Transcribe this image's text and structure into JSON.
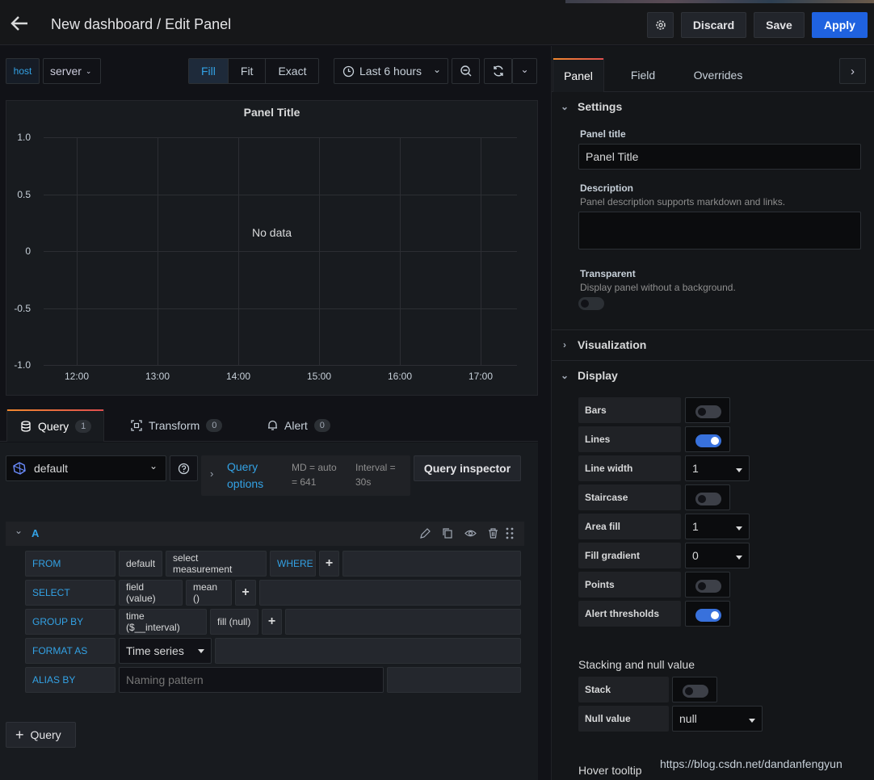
{
  "header": {
    "title": "New dashboard / Edit Panel",
    "discard_label": "Discard",
    "save_label": "Save",
    "apply_label": "Apply"
  },
  "toolbar": {
    "var_name": "host",
    "var_value": "server",
    "fit_modes": [
      "Fill",
      "Fit",
      "Exact"
    ],
    "active_fit": "Fill",
    "time_range": "Last 6 hours"
  },
  "panel": {
    "title": "Panel Title",
    "no_data": "No data"
  },
  "chart_data": {
    "type": "line",
    "title": "Panel Title",
    "series": [],
    "x_ticks": [
      "12:00",
      "13:00",
      "14:00",
      "15:00",
      "16:00",
      "17:00"
    ],
    "y_ticks": [
      "1.0",
      "0.5",
      "0",
      "-0.5",
      "-1.0"
    ],
    "ylim": [
      -1.0,
      1.0
    ],
    "grid": true,
    "annotation": "No data"
  },
  "query_tabs": [
    {
      "label": "Query",
      "count": "1"
    },
    {
      "label": "Transform",
      "count": "0"
    },
    {
      "label": "Alert",
      "count": "0"
    }
  ],
  "datasource": {
    "name": "default",
    "query_options_label1": "Query",
    "query_options_label2": "options",
    "md_line1": "MD = auto",
    "md_line2": "= 641",
    "interval_line1": "Interval =",
    "interval_line2": "30s",
    "inspector_label": "Query inspector"
  },
  "query": {
    "ref_id": "A",
    "rows": {
      "from_label": "FROM",
      "from_default": "default",
      "from_measurement": "select measurement",
      "where_label": "WHERE",
      "select_label": "SELECT",
      "select_field": "field (value)",
      "select_fn": "mean ()",
      "group_label": "GROUP BY",
      "group_time": "time ($__interval)",
      "group_fill": "fill (null)",
      "format_label": "FORMAT AS",
      "format_value": "Time series",
      "alias_label": "ALIAS BY",
      "alias_placeholder": "Naming pattern"
    },
    "add_query_label": "Query"
  },
  "options": {
    "tabs": [
      "Panel",
      "Field",
      "Overrides"
    ],
    "settings_title": "Settings",
    "panel_title_label": "Panel title",
    "panel_title_value": "Panel Title",
    "description_label": "Description",
    "description_hint": "Panel description supports markdown and links.",
    "transparent_label": "Transparent",
    "transparent_hint": "Display panel without a background.",
    "visualization_title": "Visualization",
    "display_title": "Display",
    "display_rows": [
      {
        "label": "Bars",
        "kind": "switch",
        "on": false
      },
      {
        "label": "Lines",
        "kind": "switch",
        "on": true
      },
      {
        "label": "Line width",
        "kind": "select",
        "value": "1"
      },
      {
        "label": "Staircase",
        "kind": "switch",
        "on": false
      },
      {
        "label": "Area fill",
        "kind": "select",
        "value": "1"
      },
      {
        "label": "Fill gradient",
        "kind": "select",
        "value": "0"
      },
      {
        "label": "Points",
        "kind": "switch",
        "on": false
      },
      {
        "label": "Alert thresholds",
        "kind": "switch",
        "on": true
      }
    ],
    "stacking_title": "Stacking and null value",
    "stack_label": "Stack",
    "null_label": "Null value",
    "null_value": "null",
    "hover_title": "Hover tooltip"
  },
  "watermark": "https://blog.csdn.net/dandanfengyun",
  "colors": {
    "accent": "#1f62e0",
    "link": "#33a2e5",
    "switch_on": "#3871dc"
  }
}
